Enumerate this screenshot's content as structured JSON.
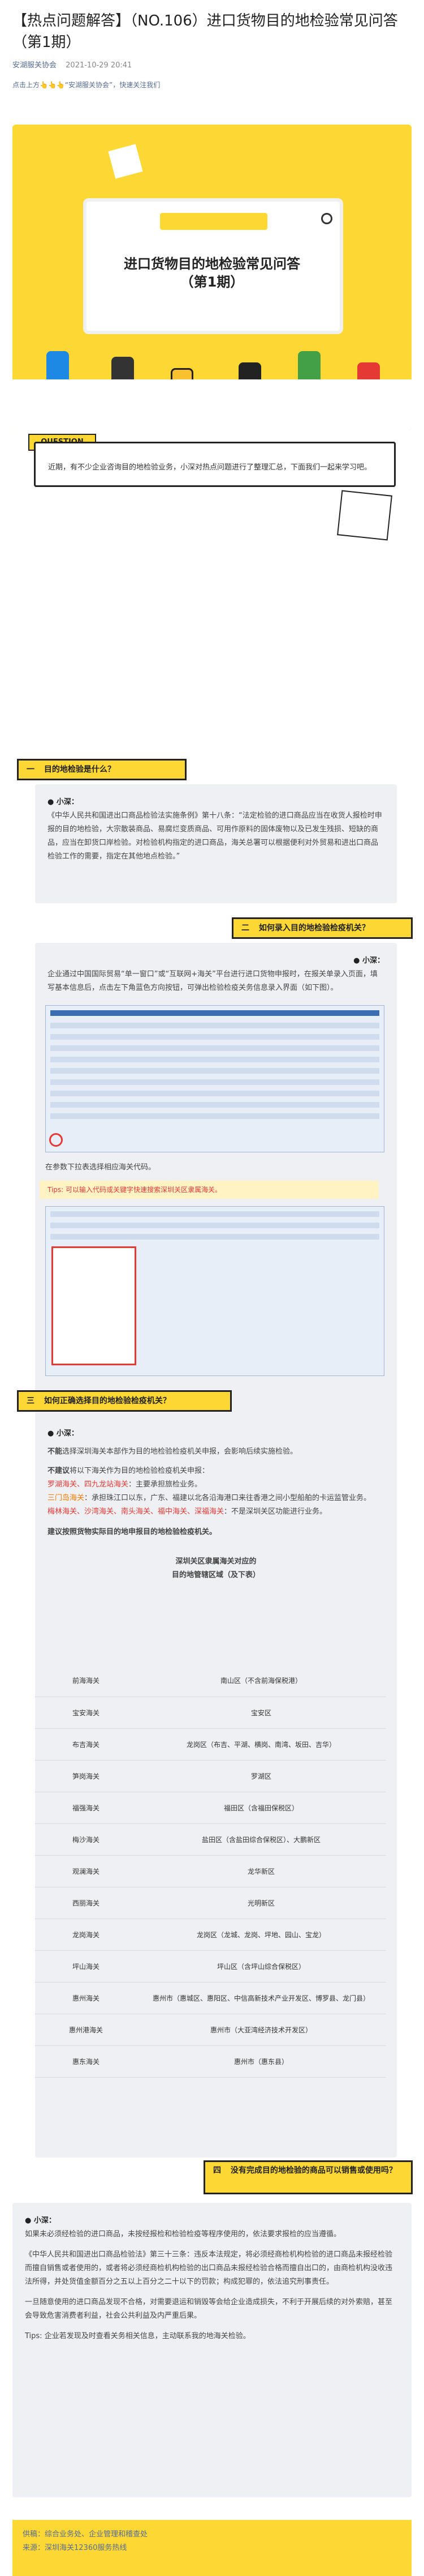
{
  "article": {
    "title": "【热点问题解答】（NO.106）进口货物目的地检验常见问答 （第1期）",
    "account": "安湖服关协会",
    "date": "2021-10-29 20:41",
    "follow": "点击上方👆👆👆“安湖服关协会”，快速关注我们"
  },
  "hero": {
    "title_line1": "进口货物目的地检验常见问答",
    "title_line2": "（第1期）"
  },
  "question": {
    "tag": "QUESTION",
    "text": "近期，有不少企业咨询目的地检验业务，小深对热点问题进行了整理汇总，下面我们一起来学习吧。"
  },
  "sections": [
    {
      "num": "一",
      "heading": "目的地检验是什么？",
      "tip": "● 小深：",
      "body": "《中华人民共和国进出口商品检验法实施条例》第十八条：“法定检验的进口商品应当在收货人报检时申报的目的地检验，大宗散装商品、易腐烂变质商品、可用作原料的固体废物以及已发生残损、短缺的商品，应当在卸货口岸检验。对检验机构指定的进口商品，海关总署可以根据便利对外贸易和进出口商品检验工作的需要，指定在其他地点检验。”"
    },
    {
      "num": "二",
      "heading": "如何录入目的地检验检疫机关？",
      "tip": "● 小深：",
      "body": "企业通过中国国际贸易“单一窗口”或“互联网+海关”平台进行进口货物申报时，在报关单录入页面，填写基本信息后，点击左下角蓝色方向按钮，可弹出检验检疫关务信息录入界面（如下图）。",
      "note": "在参数下拉表选择相应海关代码。",
      "tipbar": "Tips: 可以输入代码或关键字快速搜索深圳关区隶属海关。"
    },
    {
      "num": "三",
      "heading": "如何正确选择目的地检验检疫机关？",
      "tip": "● 小深：",
      "p1_lead": "不能",
      "p1": "选择深圳海关本部作为目的地检验检疫机关申报，会影响后续实施检验。",
      "p2_lead": "不建议",
      "p2": "将以下海关作为目的地检验检疫机关申报：",
      "p3_red": "罗湖海关、四九龙站海关",
      "p3": "：主要承担旅检业务。",
      "p4_orange": "三门岛海关",
      "p4": "：承担珠江口以东，广东、福建以北各沿海港口来往香港之间小型船舶的卡运监管业务。",
      "p5_red": "梅林海关、沙湾海关、南头海关、福中海关、深福海关",
      "p5": "：不是深圳关区功能进行业务。",
      "p6": "建议按照货物实际目的地申报目的地检验检疫机关。",
      "table": {
        "title_line1": "深圳关区隶属海关对应的",
        "title_line2": "目的地管辖区域（及下表）",
        "rows": [
          {
            "k": "前海海关",
            "v": "南山区（不含前海保税港）"
          },
          {
            "k": "宝安海关",
            "v": "宝安区"
          },
          {
            "k": "布吉海关",
            "v": "龙岗区（布吉、平湖、横岗、南湾、坂田、吉华）"
          },
          {
            "k": "笋岗海关",
            "v": "罗湖区"
          },
          {
            "k": "福强海关",
            "v": "福田区（含福田保税区）"
          },
          {
            "k": "梅沙海关",
            "v": "盐田区（含盐田综合保税区）、大鹏新区"
          },
          {
            "k": "观澜海关",
            "v": "龙华新区"
          },
          {
            "k": "西丽海关",
            "v": "光明新区"
          },
          {
            "k": "龙岗海关",
            "v": "龙岗区（龙城、龙岗、坪地、园山、宝龙）"
          },
          {
            "k": "坪山海关",
            "v": "坪山区（含坪山综合保税区）"
          },
          {
            "k": "惠州海关",
            "v": "惠州市（惠城区、惠阳区、中信高新技术产业开发区、博罗县、龙门县）"
          },
          {
            "k": "惠州港海关",
            "v": "惠州市（大亚湾经济技术开发区）"
          },
          {
            "k": "惠东海关",
            "v": "惠州市（惠东县）"
          }
        ]
      }
    },
    {
      "num": "四",
      "heading": "没有完成目的地检验的商品可以销售或使用吗？",
      "tip": "● 小深：",
      "body1": "如果未必须经检验的进口商品，未按经报检和检验检疫等程序使用的，依法要求报检的应当遵循。",
      "body2": "《中华人民共和国进出口商品检验法》第三十三条：违反本法规定，将必须经商检机构检验的进口商品未报经检验而擅自销售或者使用的，或者将必须经商检机构检验的出口商品未报经检验合格而擅自出口的，由商检机构没收违法所得，并处货值金额百分之五以上百分之二十以下的罚款；构成犯罪的，依法追究刑事责任。",
      "body3": "一旦随意使用的进口商品发现不合格，对需要退运和销毁等会给企业造成损失，不利于开展后续的对外索赔，甚至会导致危害消费者利益，社会公共利益及内严重后果。",
      "tips": "Tips: 企业若发现及时查看关务相关信息，主动联系我的地海关检验。"
    }
  ],
  "footer": {
    "line1": "供稿：综合业务处、企业管理和稽查处",
    "line2": "来源：深圳海关12360服务热线"
  },
  "colors": {
    "accent": "#fdd835",
    "card": "#eef0f3",
    "red": "#e53935",
    "orange": "#f57c00",
    "link": "#576b95"
  }
}
